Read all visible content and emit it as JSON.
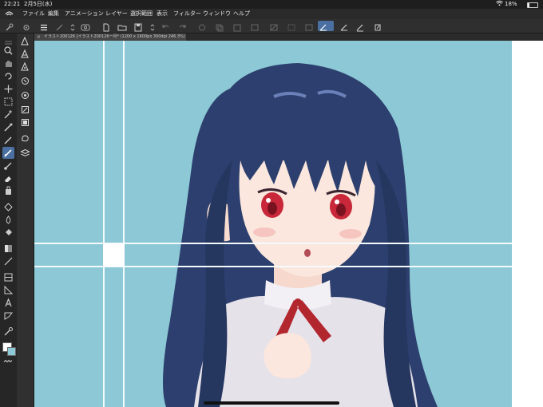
{
  "status_bar": {
    "time": "22:21",
    "date": "2月5日(水)",
    "battery": "18%"
  },
  "menu": {
    "items": [
      "ファイル",
      "編集",
      "アニメーション",
      "レイヤー",
      "選択範囲",
      "表示",
      "フィルター",
      "ウィンドウ",
      "ヘルプ"
    ]
  },
  "document": {
    "tab_title": "イラスト200126 [イラスト200126一月* (1200 x 1600px 300dpi 246.3%)",
    "close_glyph": "×"
  },
  "colors": {
    "canvas_background": "#8cc8d5",
    "hair": "#2c3f6e",
    "skin": "#fbe7dd",
    "eyes": "#c8283a",
    "ribbon": "#b2262e",
    "active_tool": "#4a6fa0",
    "ui_dark": "#262626"
  },
  "left_tools": [
    "zoom-icon",
    "hand-icon",
    "rotate-icon",
    "move-icon",
    "rect-select-icon",
    "auto-select-icon",
    "eyedropper-icon",
    "pen-icon",
    "pencil-icon",
    "brush-icon",
    "airbrush-icon",
    "eraser-icon",
    "decoration-icon",
    "blend-icon",
    "fill-icon",
    "gradient-icon",
    "figure-icon",
    "frame-icon",
    "ruler-icon",
    "text-icon",
    "balloon-icon",
    "correction-icon",
    "color-swatch-icon"
  ],
  "active_tool": "pen-icon"
}
